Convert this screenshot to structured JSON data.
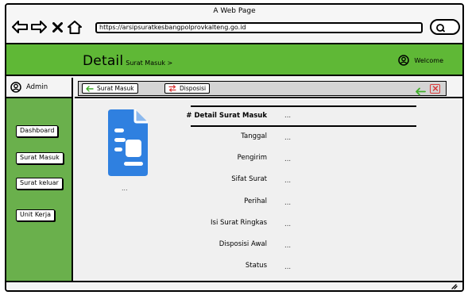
{
  "window": {
    "title": "A Web Page"
  },
  "browser": {
    "url": "https://arsipsuratkesbangpolprovkalteng.go.id",
    "icons": [
      "back-arrow-icon",
      "forward-arrow-icon",
      "close-x-icon",
      "home-icon",
      "search-icon"
    ]
  },
  "header": {
    "title": "Detail",
    "crumb": "Surat Masuk >",
    "welcome": "Welcome"
  },
  "sidebar": {
    "user": "Admin",
    "items": [
      {
        "label": "Dashboard"
      },
      {
        "label": "Surat Masuk"
      },
      {
        "label": "Surat keluar"
      },
      {
        "label": "Unit Kerja"
      }
    ]
  },
  "toolbar": {
    "surat_masuk": "Surat Masuk",
    "disposisi": "Disposisi"
  },
  "document": {
    "caption": "..."
  },
  "details": {
    "fields": [
      {
        "label": "# Detail Surat Masuk",
        "value": "..."
      },
      {
        "label": "Tanggal",
        "value": "..."
      },
      {
        "label": "Pengirim",
        "value": "..."
      },
      {
        "label": "Sifat Surat",
        "value": "..."
      },
      {
        "label": "Perihal",
        "value": "..."
      },
      {
        "label": "Isi Surat Ringkas",
        "value": "..."
      },
      {
        "label": "Disposisi Awal",
        "value": "..."
      },
      {
        "label": "Status",
        "value": "..."
      }
    ]
  },
  "colors": {
    "header_green": "#5fb836",
    "sidebar_green": "#6ab04c",
    "doc_blue": "#2f80e0",
    "back_green": "#3fae2a",
    "close_red": "#d93a3a"
  }
}
